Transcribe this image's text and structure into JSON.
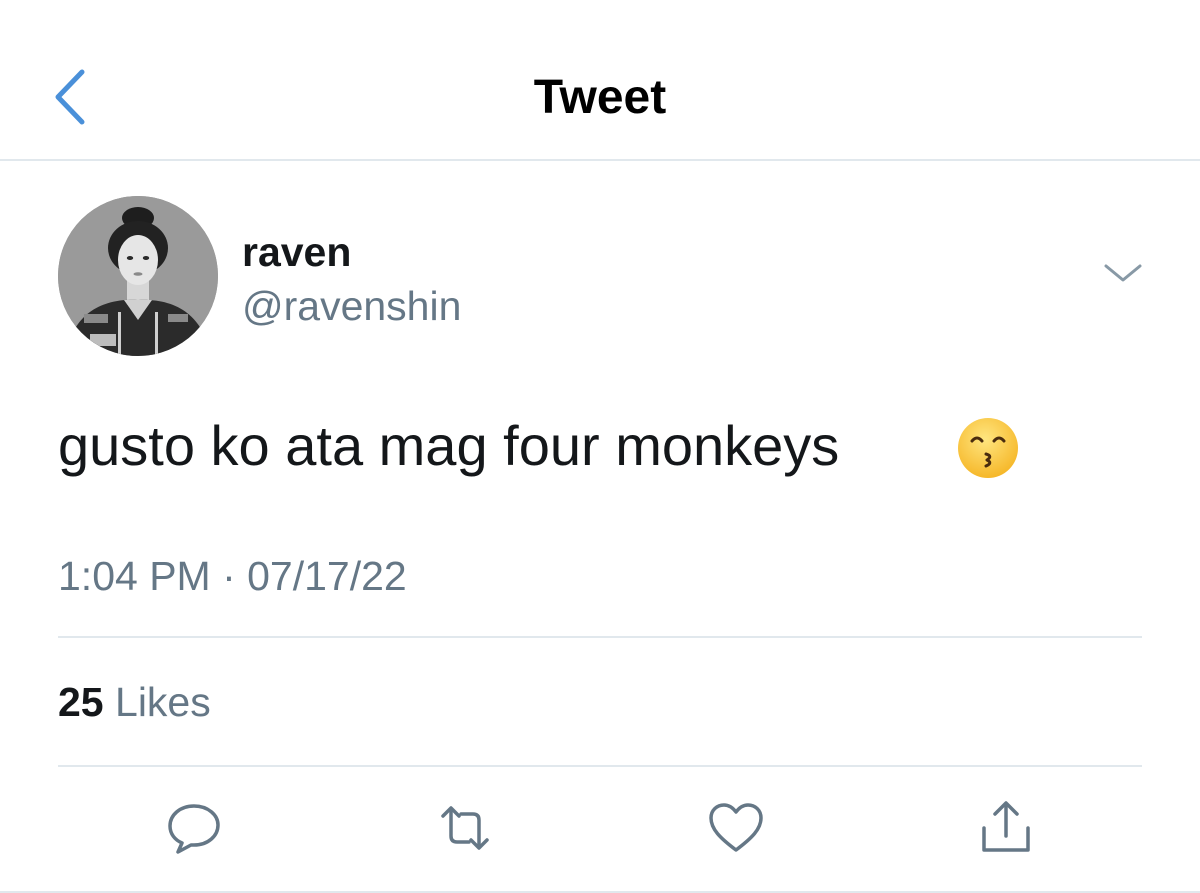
{
  "colors": {
    "accent": "#4a90d9",
    "text_primary": "#14171a",
    "text_secondary": "#657786",
    "divider": "#e1e8ed"
  },
  "nav": {
    "back_icon": "chevron-left-icon",
    "title": "Tweet"
  },
  "tweet": {
    "author": {
      "display_name": "raven",
      "handle": "@ravenshin",
      "avatar": "avatar"
    },
    "more_icon": "chevron-down-icon",
    "text": "gusto ko ata mag four monkeys",
    "emoji": "😙",
    "timestamp": "1:04 PM · 07/17/22"
  },
  "stats": {
    "likes_count": "25",
    "likes_label": "Likes"
  },
  "actions": [
    {
      "name": "reply",
      "icon": "speech-bubble-icon"
    },
    {
      "name": "retweet",
      "icon": "retweet-icon"
    },
    {
      "name": "like",
      "icon": "heart-icon"
    },
    {
      "name": "share",
      "icon": "share-icon"
    }
  ]
}
